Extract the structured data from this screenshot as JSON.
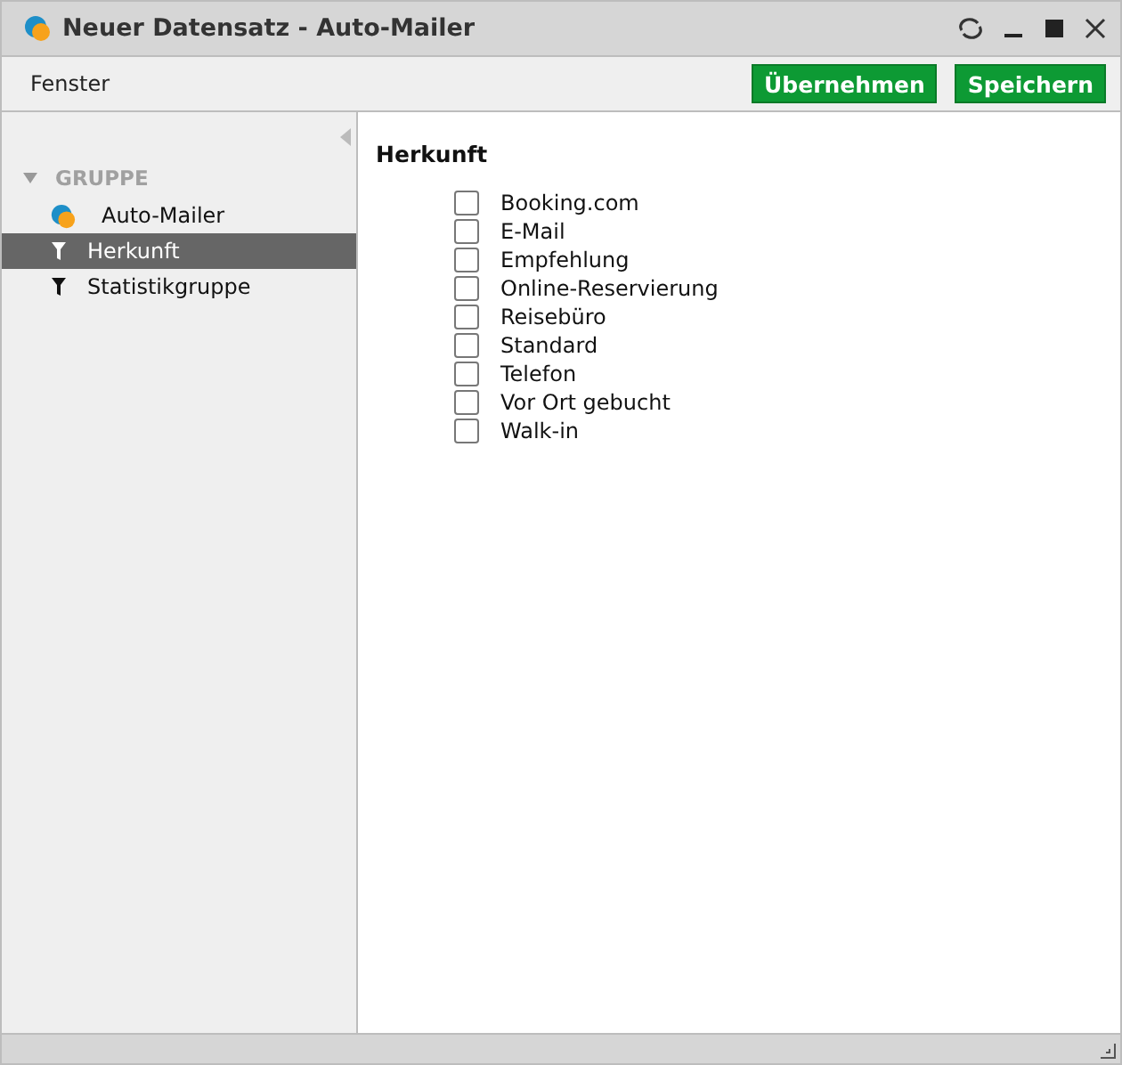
{
  "window": {
    "title": "Neuer Datensatz - Auto-Mailer"
  },
  "menu": [
    "Fenster"
  ],
  "buttons": [
    "Übernehmen",
    "Speichern"
  ],
  "sidebar": {
    "groups": [
      {
        "label": "GRUPPE",
        "expanded": true,
        "children": [
          {
            "label": "Auto-Mailer",
            "kind": "app",
            "selected": false
          },
          {
            "label": "Herkunft",
            "kind": "filter",
            "selected": true
          },
          {
            "label": "Statistikgruppe",
            "kind": "filter",
            "selected": false
          }
        ]
      }
    ]
  },
  "panel": {
    "heading": "Herkunft",
    "options": [
      {
        "label": "Booking.com",
        "checked": false
      },
      {
        "label": "E-Mail",
        "checked": false
      },
      {
        "label": "Empfehlung",
        "checked": false
      },
      {
        "label": "Online-Reservierung",
        "checked": false
      },
      {
        "label": "Reisebüro",
        "checked": false
      },
      {
        "label": "Standard",
        "checked": false
      },
      {
        "label": "Telefon",
        "checked": false
      },
      {
        "label": "Vor Ort gebucht",
        "checked": false
      },
      {
        "label": "Walk-in",
        "checked": false
      }
    ]
  }
}
